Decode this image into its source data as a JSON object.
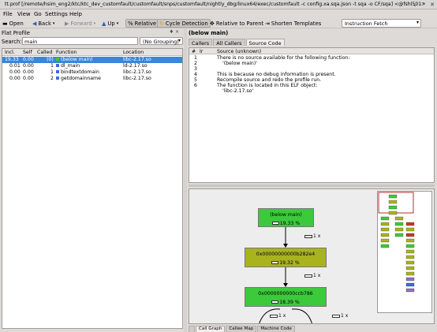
{
  "window": {
    "title": "tt.prof [/remote/hsim_eng2/ktc/ktc_dev_customfault/customfault/snps/customfault/nightly_dbg/linux64/exec/customfault -c config.xa.sqa.json -t sqa -o CF/sqa] <@fshl501>",
    "minimize_glyph": "⌄",
    "maximize_glyph": "⌃",
    "close_glyph": "✕"
  },
  "menu": [
    "File",
    "View",
    "Go",
    "Settings",
    "Help"
  ],
  "toolbar": {
    "open_label": "Open",
    "back_label": "Back",
    "forward_label": "Forward",
    "up_label": "Up",
    "relative_label": "Relative",
    "cycle_label": "Cycle Detection",
    "relative_parent_label": "Relative to Parent",
    "shorten_label": "Shorten Templates",
    "event_value": "Instruction Fetch",
    "back_glyph": "◀",
    "forward_glyph": "▶",
    "up_glyph": "▲",
    "dropdown_glyph": "▾"
  },
  "left_panel": {
    "title": "Flat Profile",
    "header_buttons": "♦ ×",
    "search_label": "Search:",
    "search_value": "main",
    "grouping_value": "(No Grouping)",
    "columns": [
      "Incl.",
      "Self",
      "Called",
      "Function",
      "Location"
    ],
    "rows": [
      {
        "incl": "19.33",
        "self": "0.00",
        "called": "(0)",
        "function": "(below main)",
        "location": "libc-2.17.so",
        "color": "#3cc93c"
      },
      {
        "incl": "0.01",
        "self": "0.00",
        "called": "1",
        "function": "dl_main",
        "location": "ld-2.17.so",
        "color": "#3d6ad6"
      },
      {
        "incl": "0.00",
        "self": "0.00",
        "called": "1",
        "function": "bindtextdomain",
        "location": "libc-2.17.so",
        "color": "#3d6ad6"
      },
      {
        "incl": "0.00",
        "self": "0.00",
        "called": "2",
        "function": "getdomainname",
        "location": "libc-2.17.so",
        "color": "#3d6ad6"
      }
    ]
  },
  "right_panel": {
    "title": "(below main)",
    "tabs": [
      "Callers",
      "All Callers",
      "Source Code"
    ],
    "source_columns": [
      "#",
      "Ir",
      "Source (unknown)"
    ],
    "source_lines": [
      {
        "n": "1",
        "text": "There is no source available for the following function:"
      },
      {
        "n": "2",
        "text": "'(below main)'"
      },
      {
        "n": "3",
        "text": ""
      },
      {
        "n": "4",
        "text": "This is because no debug information is present."
      },
      {
        "n": "5",
        "text": "Recompile source and redo the profile run."
      },
      {
        "n": "6",
        "text": "The function is located in this ELF object:"
      },
      {
        "n": "",
        "text": "'libc-2.17.so'"
      }
    ],
    "bottom_tabs": [
      "",
      "Call Graph",
      "Callee Map",
      "Machine Code"
    ]
  },
  "call_graph": {
    "nodes": [
      {
        "label": "(below main)",
        "pct": "19.33 %",
        "color": "#3cc93c",
        "fill": 0.6
      },
      {
        "label": "0x00000000000b282e4",
        "pct": "19.32 %",
        "color": "#a8b31e",
        "fill": 0.6
      },
      {
        "label": "0x0000000000ccb786",
        "pct": "18.39 %",
        "color": "#3cc93c",
        "fill": 0.58
      }
    ],
    "edges": [
      {
        "label": "1 x"
      },
      {
        "label": "1 x"
      },
      {
        "label": "1 x"
      },
      {
        "label": "1 x"
      }
    ]
  },
  "colors": {
    "selection": "#3b86d8",
    "node_green": "#3cc93c",
    "node_olive": "#a8b31e"
  }
}
